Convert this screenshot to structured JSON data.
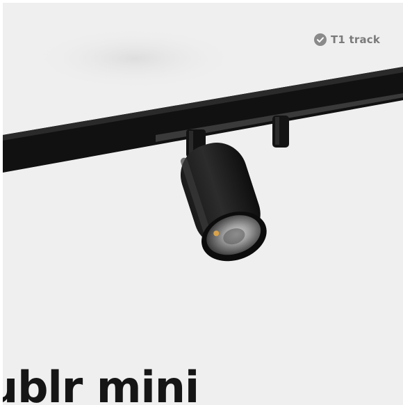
{
  "product_card": {
    "badge_label": "T1 track",
    "badge_icon": "check-circle-icon",
    "product_name": "ublr mini",
    "image_alt": "Black track spotlight mounted on a black ceiling track rail"
  },
  "colors": {
    "card_background": "#efefef",
    "badge_text": "#7a7a7a",
    "title_text": "#151515",
    "track": "#111111"
  }
}
